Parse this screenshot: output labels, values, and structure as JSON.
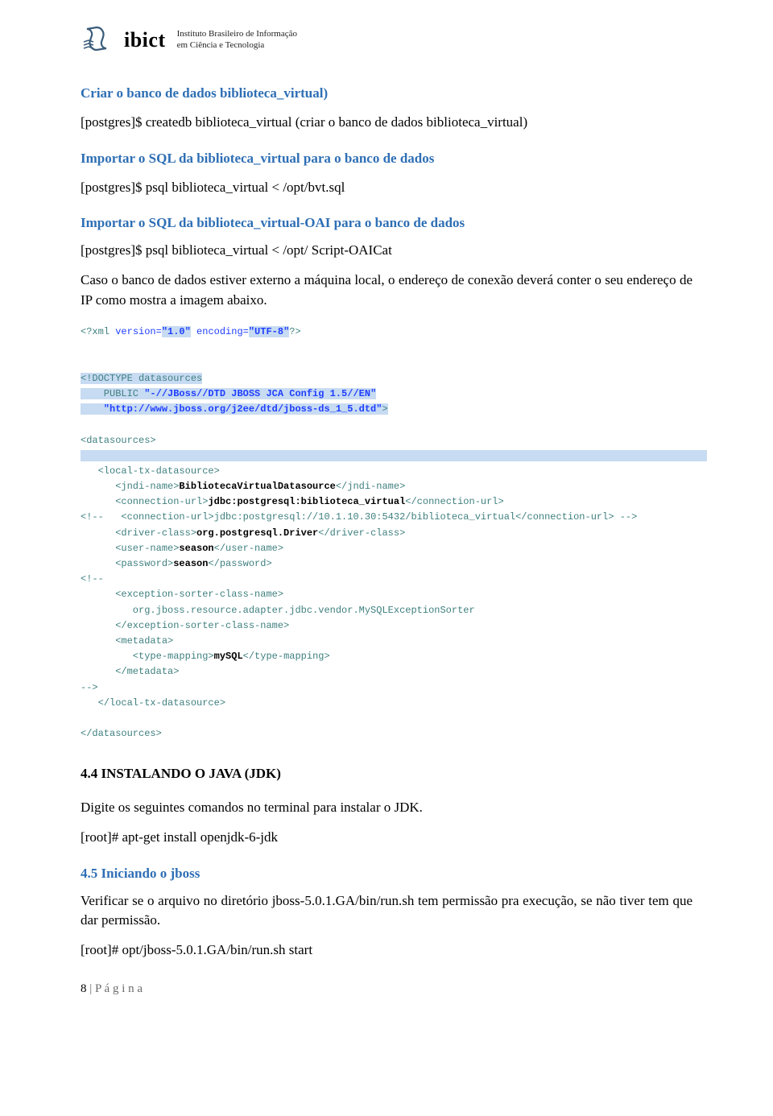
{
  "header": {
    "brand": "ibict",
    "tagline_line1": "Instituto Brasileiro de Informação",
    "tagline_line2": "em Ciência e Tecnologia"
  },
  "sections": {
    "s1_title": "Criar o banco de dados biblioteca_virtual)",
    "s1_cmd": "[postgres]$ createdb biblioteca_virtual (criar o banco de dados biblioteca_virtual)",
    "s2_title": "Importar o SQL da biblioteca_virtual para o banco de dados",
    "s2_cmd": "[postgres]$ psql biblioteca_virtual < /opt/bvt.sql",
    "s3_title": "Importar o SQL da biblioteca_virtual-OAI  para o banco de dados",
    "s3_cmd": "[postgres]$ psql biblioteca_virtual < /opt/ Script-OAICat",
    "s3_note": "Caso o banco de dados estiver externo a máquina local, o endereço de conexão deverá conter o seu endereço de IP como mostra a imagem abaixo.",
    "s4_title": "4.4 INSTALANDO O JAVA (JDK)",
    "s4_body": "Digite os seguintes comandos no terminal para instalar o JDK.",
    "s4_cmd": "[root]# apt-get install openjdk-6-jdk",
    "s5_title": "4.5 Iniciando o jboss",
    "s5_body": "Verificar se o arquivo no diretório jboss-5.0.1.GA/bin/run.sh tem permissão pra execução, se não tiver tem que dar permissão.",
    "s5_cmd": "[root]# opt/jboss-5.0.1.GA/bin/run.sh start"
  },
  "xml": {
    "decl_open": "<?xml ",
    "decl_attrs": "version=",
    "decl_v1": "\"1.0\"",
    "decl_enc_lbl": " encoding=",
    "decl_enc_v": "\"UTF-8\"",
    "decl_close": "?>",
    "doctype1": "<!DOCTYPE datasources",
    "doctype2": "    PUBLIC ",
    "doctype2_str": "\"-//JBoss//DTD JBOSS JCA Config 1.5//EN\"",
    "doctype3_str": "    \"http://www.jboss.org/j2ee/dtd/jboss-ds_1_5.dtd\"",
    "doctype3_close": ">",
    "root_open": "<datasources>",
    "ltd_open": "   <local-tx-datasource>",
    "jndi_open": "      <jndi-name>",
    "jndi_val": "BibliotecaVirtualDatasource",
    "jndi_close": "</jndi-name>",
    "cu_open": "      <connection-url>",
    "cu_val": "jdbc:postgresql:biblioteca_virtual",
    "cu_close": "</connection-url>",
    "cmt_open": "<!--",
    "cu2": "   <connection-url>jdbc:postgresql://10.1.10.30:5432/biblioteca_virtual</connection-url>",
    "cmt_close": " -->",
    "drv_open": "      <driver-class>",
    "drv_val": "org.postgresql.Driver",
    "drv_close": "</driver-class>",
    "un_open": "      <user-name>",
    "un_val": "season",
    "un_close": "</user-name>",
    "pw_open": "      <password>",
    "pw_val": "season",
    "pw_close": "</password>",
    "es_open": "      <exception-sorter-class-name>",
    "es_val": "         org.jboss.resource.adapter.jdbc.vendor.MySQLExceptionSorter",
    "es_close": "      </exception-sorter-class-name>",
    "md_open": "      <metadata>",
    "tm_open": "         <type-mapping>",
    "tm_val": "mySQL",
    "tm_close": "</type-mapping>",
    "md_close": "      </metadata>",
    "cmt2_close": "-->",
    "ltd_close": "   </local-tx-datasource>",
    "root_close": "</datasources>"
  },
  "footer": {
    "page_num": "8",
    "page_label": " | P á g i n a"
  }
}
